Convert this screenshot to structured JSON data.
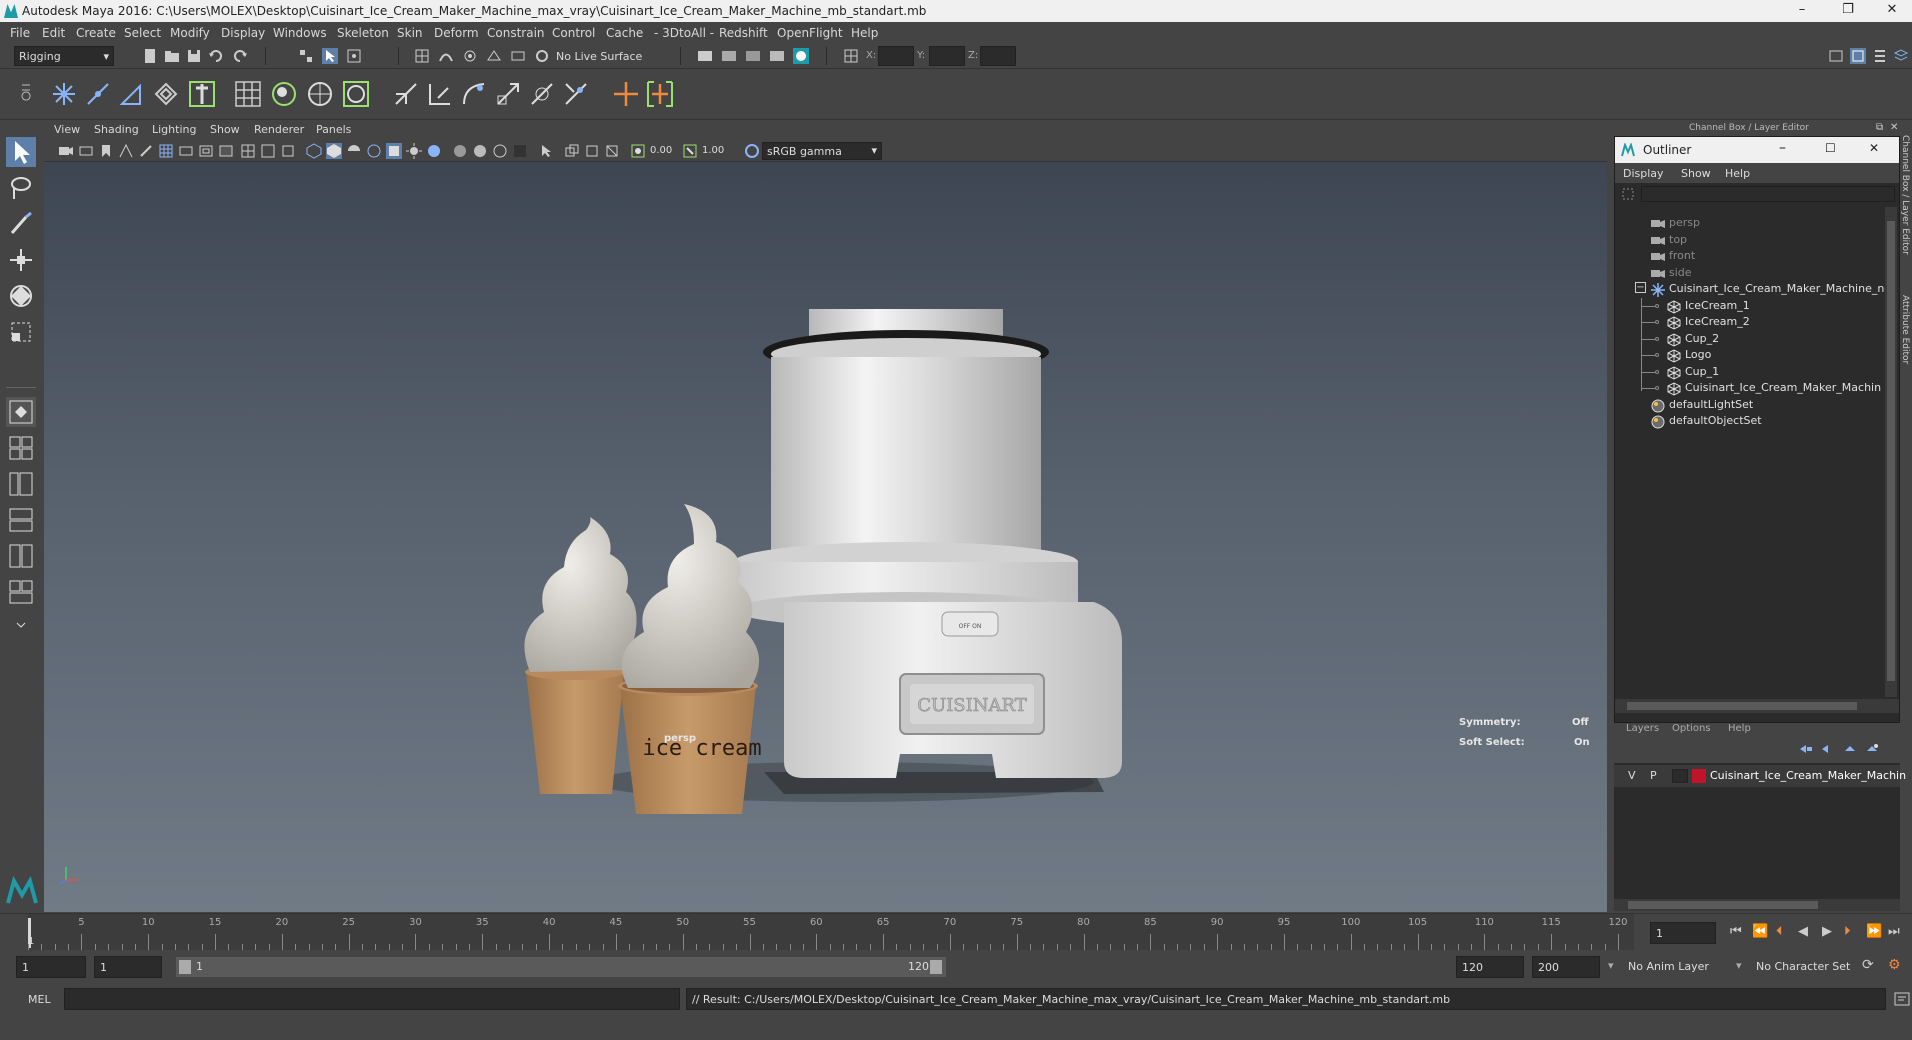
{
  "window": {
    "title": "Autodesk Maya 2016: C:\\Users\\MOLEX\\Desktop\\Cuisinart_Ice_Cream_Maker_Machine_max_vray\\Cuisinart_Ice_Cream_Maker_Machine_mb_standart.mb",
    "minimize": "–",
    "restore": "❐",
    "close": "✕"
  },
  "menu": [
    "File",
    "Edit",
    "Create",
    "Select",
    "Modify",
    "Display",
    "Windows",
    "Skeleton",
    "Skin",
    "Deform",
    "Constrain",
    "Control",
    "Cache",
    "- 3DtoAll -",
    "Redshift",
    "OpenFlight",
    "Help"
  ],
  "status": {
    "mode": "Rigging",
    "live_surface": "No Live Surface",
    "x_label": "X:",
    "y_label": "Y:",
    "z_label": "Z:"
  },
  "panel_menu": [
    "View",
    "Shading",
    "Lighting",
    "Show",
    "Renderer",
    "Panels"
  ],
  "panel_toolbar": {
    "exposure": "0.00",
    "gamma": "1.00",
    "color_space": "sRGB gamma"
  },
  "viewport": {
    "camera_label": "persp",
    "symmetry_label": "Symmetry:",
    "symmetry_value": "Off",
    "soft_select_label": "Soft Select:",
    "soft_select_value": "On",
    "cup_text": "ice cream",
    "logo_text": "CUISINART",
    "switch_text": "OFF   ON"
  },
  "channel_box_title": "Channel Box / Layer Editor",
  "side_tabs": [
    "Channel Box / Layer Editor",
    "Attribute Editor"
  ],
  "outliner": {
    "title": "Outliner",
    "menu": [
      "Display",
      "Show",
      "Help"
    ],
    "items": [
      {
        "label": "persp",
        "type": "camera",
        "dim": true,
        "indent": 0
      },
      {
        "label": "top",
        "type": "camera",
        "dim": true,
        "indent": 0
      },
      {
        "label": "front",
        "type": "camera",
        "dim": true,
        "indent": 0
      },
      {
        "label": "side",
        "type": "camera",
        "dim": true,
        "indent": 0
      },
      {
        "label": "Cuisinart_Ice_Cream_Maker_Machine_nc",
        "type": "group",
        "dim": false,
        "indent": 0
      },
      {
        "label": "IceCream_1",
        "type": "mesh",
        "dim": false,
        "indent": 1
      },
      {
        "label": "IceCream_2",
        "type": "mesh",
        "dim": false,
        "indent": 1
      },
      {
        "label": "Cup_2",
        "type": "mesh",
        "dim": false,
        "indent": 1
      },
      {
        "label": "Logo",
        "type": "mesh",
        "dim": false,
        "indent": 1
      },
      {
        "label": "Cup_1",
        "type": "mesh",
        "dim": false,
        "indent": 1
      },
      {
        "label": "Cuisinart_Ice_Cream_Maker_Machin",
        "type": "mesh",
        "dim": false,
        "indent": 1
      },
      {
        "label": "defaultLightSet",
        "type": "set",
        "dim": false,
        "indent": 0
      },
      {
        "label": "defaultObjectSet",
        "type": "set",
        "dim": false,
        "indent": 0
      }
    ]
  },
  "layers": {
    "menu": [
      "Layers",
      "Options",
      "Help"
    ],
    "row": {
      "v": "V",
      "p": "P",
      "color": "#c0142c",
      "name": "Cuisinart_Ice_Cream_Maker_Machin"
    }
  },
  "timeline": {
    "ticks": [
      5,
      10,
      15,
      20,
      25,
      30,
      35,
      40,
      45,
      50,
      55,
      60,
      65,
      70,
      75,
      80,
      85,
      90,
      95,
      100,
      105,
      110,
      115,
      120
    ],
    "current_frame": "1",
    "cursor_frame": "1"
  },
  "range": {
    "start": "1",
    "anim_start": "1",
    "slider_start": "1",
    "slider_end": "120",
    "end": "120",
    "anim_end": "200",
    "anim_layer": "No Anim Layer",
    "character_set": "No Character Set"
  },
  "cmd": {
    "lang": "MEL",
    "result": "// Result: C:/Users/MOLEX/Desktop/Cuisinart_Ice_Cream_Maker_Machine_max_vray/Cuisinart_Ice_Cream_Maker_Machine_mb_standart.mb"
  },
  "colors": {
    "accent": "#4a90d9",
    "layer_red": "#c0142c",
    "maya_teal": "#1e9aa8"
  }
}
